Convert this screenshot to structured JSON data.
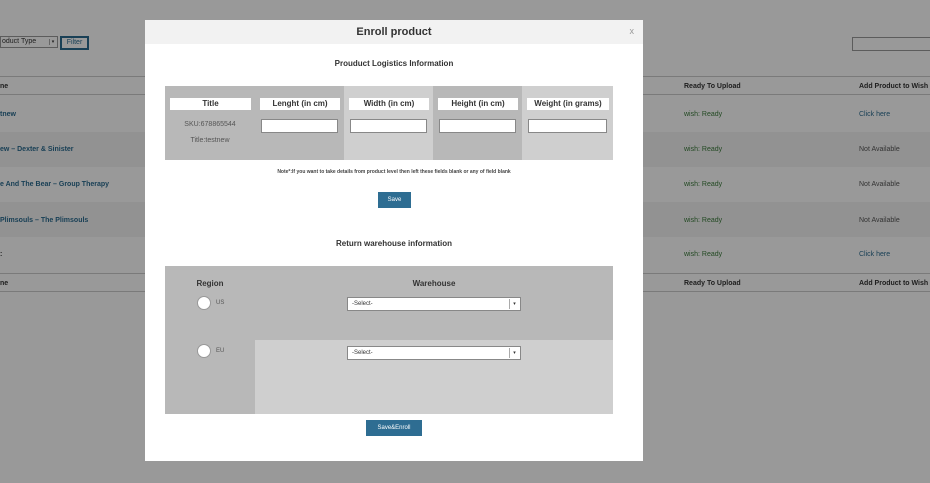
{
  "background": {
    "type_select": "oduct Type",
    "filter_label": "Filter",
    "headers": {
      "name": "ne",
      "ready": "Ready To Upload",
      "add": "Add Product to Wish"
    },
    "rows": [
      {
        "name": "tnew",
        "ready": "wish: Ready",
        "action": "Click here"
      },
      {
        "name": "ew – Dexter & Sinister",
        "ready": "wish: Ready",
        "action": "Not Available"
      },
      {
        "name": "e And The Bear – Group Therapy",
        "ready": "wish: Ready",
        "action": "Not Available"
      },
      {
        "name": "Plimsouls – The Plimsouls",
        "ready": "wish: Ready",
        "action": "Not Available"
      },
      {
        "name": ":",
        "ready": "wish: Ready",
        "action": "Click here"
      }
    ]
  },
  "modal": {
    "title": "Enroll product",
    "close": "x",
    "logistics_title": "Prouduct Logistics Information",
    "columns": {
      "title": "Title",
      "length": "Lenght (in cm)",
      "width": "Width (in cm)",
      "height": "Height (in cm)",
      "weight": "Weight (in grams)"
    },
    "sku": "SKU:678865544",
    "product_title": "Title:testnew",
    "note": "Note*:If you want to take details from product level then left these fields blank or any of field blank",
    "save_label": "Save",
    "warehouse_title": "Return warehouse information",
    "region_header": "Region",
    "warehouse_header": "Warehouse",
    "regions": [
      {
        "label": "US",
        "select": "-Select-"
      },
      {
        "label": "EU",
        "select": "-Select-"
      }
    ],
    "save_enroll_label": "Save&Enroll"
  }
}
